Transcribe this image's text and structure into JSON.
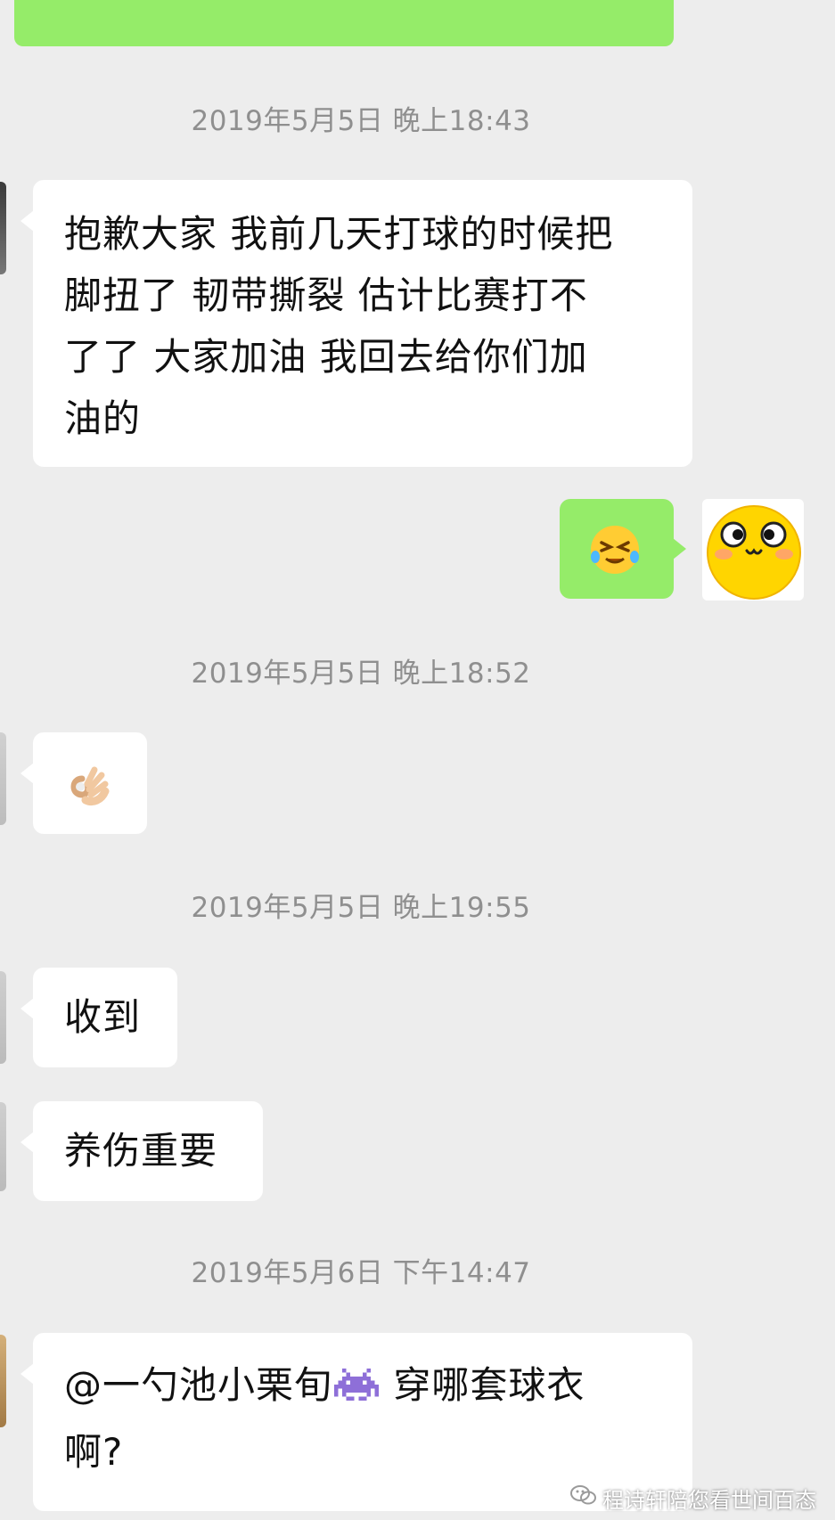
{
  "chat": {
    "timestamps": [
      "2019年5月5日 晚上18:43",
      "2019年5月5日 晚上18:52",
      "2019年5月5日 晚上19:55",
      "2019年5月6日 下午14:47"
    ],
    "messages": {
      "apology": {
        "line1": "抱歉大家 我前几天打球的时候把",
        "line2": "脚扭了 韧带撕裂 估计比赛打不",
        "line3": "了了 大家加油 我回去给你们加",
        "line4": "油的"
      },
      "sent_reply_emoji": "laugh-cry-emoji",
      "ok_hand_emoji": "ok-hand-emoji",
      "received": "收到",
      "take_care": "养伤重要",
      "question": {
        "mention": "@一勺池小栗旬",
        "mention_emoji": "space-invader-emoji",
        "rest": " 穿哪套球衣",
        "line2": "啊?"
      }
    }
  },
  "watermark": {
    "text": "程诗轩陪您看世间百态",
    "icon": "wechat-official-account-icon"
  },
  "colors": {
    "background": "#ededed",
    "incoming_bubble": "#ffffff",
    "outgoing_bubble": "#95ec69",
    "timestamp": "#8f8f8f"
  }
}
